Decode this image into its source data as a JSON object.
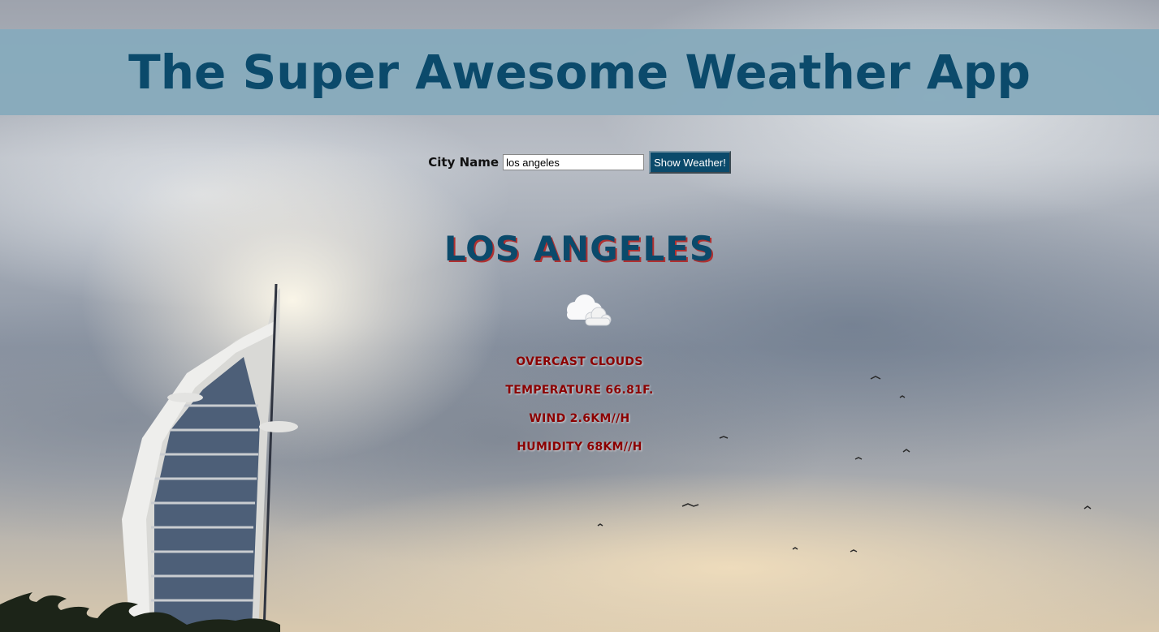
{
  "header": {
    "title": "The Super Awesome Weather App"
  },
  "search": {
    "label": "City Name",
    "input_value": "los angeles",
    "button_label": "Show Weather!"
  },
  "weather": {
    "city": "LOS ANGELES",
    "icon": "overcast-clouds-icon",
    "description": "OVERCAST CLOUDS",
    "temperature_label": "TEMPERATURE",
    "temperature_value": "66.81F.",
    "wind_label": "WIND",
    "wind_value": "2.6KM//H",
    "humidity_label": "HUMIDITY",
    "humidity_value": "68KM//H"
  },
  "colors": {
    "header_bg": "#87aabc",
    "title": "#0b4a6b",
    "info_text": "#8b0000",
    "button_bg": "#0b4a6b"
  }
}
